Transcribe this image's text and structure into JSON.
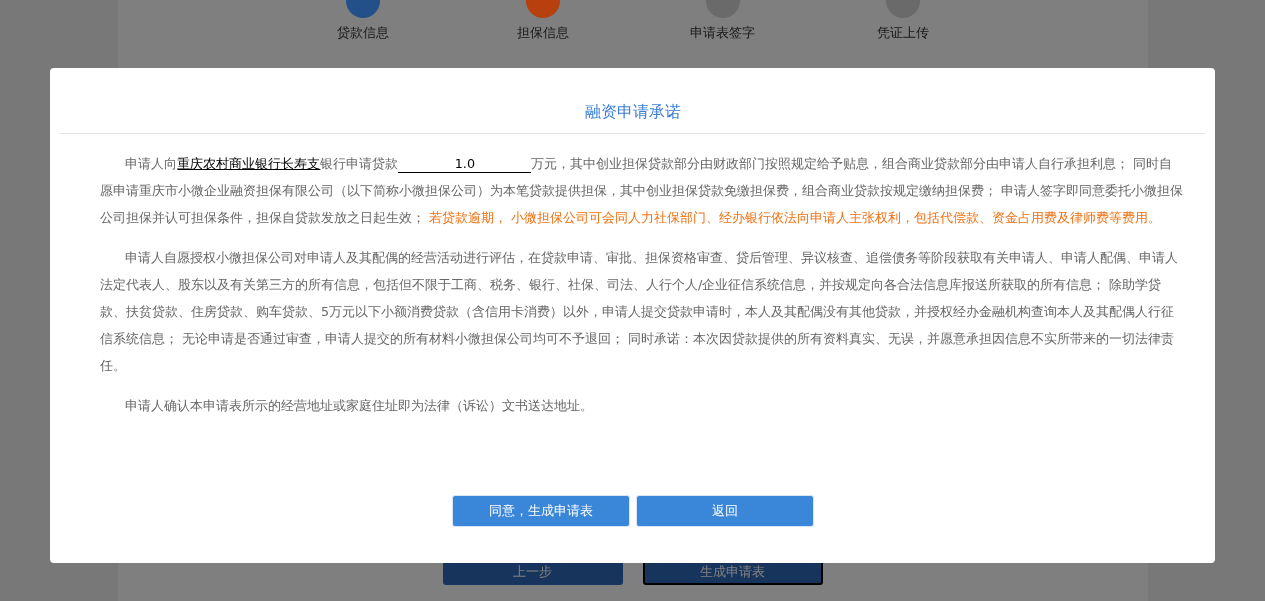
{
  "steps": [
    {
      "label": "贷款信息",
      "color": "#24508a"
    },
    {
      "label": "担保信息",
      "color": "#b8400e"
    },
    {
      "label": "申请表签字",
      "color": "#6a6a6a"
    },
    {
      "label": "凭证上传",
      "color": "#6a6a6a"
    }
  ],
  "page_buttons": [
    {
      "label": "上一步",
      "selected": false
    },
    {
      "label": "生成申请表",
      "selected": true
    }
  ],
  "dialog": {
    "title": "融资申请承诺",
    "paragraph_1": {
      "before_bank": "申请人向",
      "bank": "重庆农村商业银行长寿支",
      "before_amount": "银行申请贷款",
      "amount": "1.0",
      "after_amount": "万元，其中创业担保贷款部分由财政部门按照规定给予贴息，组合商业贷款部分由申请人自行承担利息； 同时自愿申请重庆市小微企业融资担保有限公司（以下简称小微担保公司）为本笔贷款提供担保，其中创业担保贷款免缴担保费，组合商业贷款按规定缴纳担保费； 申请人签字即同意委托小微担保公司担保并认可担保条件，担保自贷款发放之日起生效；",
      "warning": "若贷款逾期， 小微担保公司可会同人力社保部门、经办银行依法向申请人主张权利，包括代偿款、资金占用费及律师费等费用。"
    },
    "paragraphs": [
      "申请人自愿授权小微担保公司对申请人及其配偶的经营活动进行评估，在贷款申请、审批、担保资格审查、贷后管理、异议核查、追偿债务等阶段获取有关申请人、申请人配偶、申请人法定代表人、股东以及有关第三方的所有信息，包括但不限于工商、税务、银行、社保、司法、人行个人/企业征信系统信息，并按规定向各合法信息库报送所获取的所有信息； 除助学贷款、扶贫贷款、住房贷款、购车贷款、5万元以下小额消费贷款（含信用卡消费）以外，申请人提交贷款申请时，本人及其配偶没有其他贷款，并授权经办金融机构查询本人及其配偶人行征信系统信息； 无论申请是否通过审查，申请人提交的所有材料小微担保公司均可不予退回； 同时承诺：本次因贷款提供的所有资料真实、无误，并愿意承担因信息不实所带来的一切法律责任。",
      "申请人确认本申请表所示的经营地址或家庭住址即为法律（诉讼）文书送达地址。"
    ],
    "buttons": [
      "同意，生成申请表",
      "返回"
    ]
  }
}
